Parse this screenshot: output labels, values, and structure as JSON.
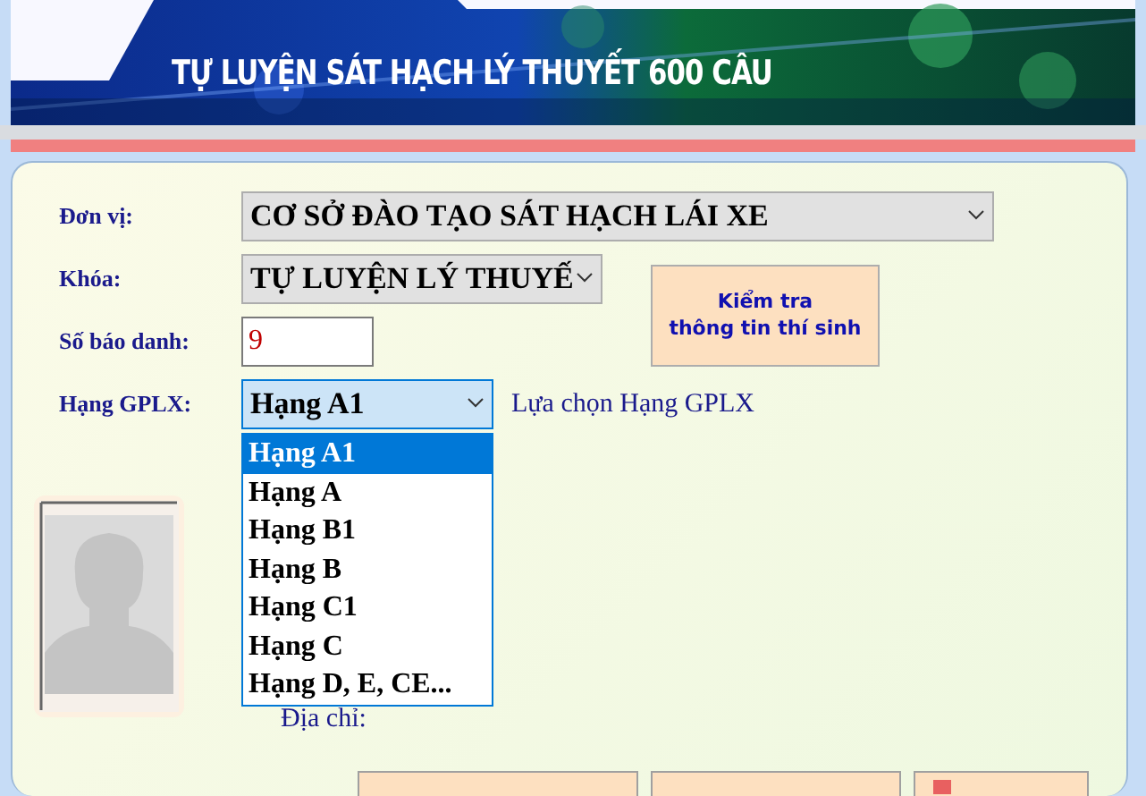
{
  "banner": {
    "title": "TỰ LUYỆN SÁT HẠCH LÝ THUYẾT 600 CÂU"
  },
  "form": {
    "fields": [
      {
        "kind": "select",
        "label": "Đơn vị:",
        "value": "CƠ SỞ ĐÀO TẠO SÁT HẠCH LÁI XE"
      },
      {
        "kind": "select",
        "label": "Khóa:",
        "value": "TỰ LUYỆN LÝ THUYẾ"
      },
      {
        "kind": "input",
        "label": "Số báo danh:",
        "value": "9"
      },
      {
        "kind": "select",
        "label": "Hạng GPLX:",
        "value": "Hạng A1",
        "hint": "Lựa chọn Hạng GPLX",
        "expanded": true,
        "options": [
          {
            "label": "Hạng A1",
            "selected": true
          },
          {
            "label": "Hạng A",
            "selected": false
          },
          {
            "label": "Hạng B1",
            "selected": false
          },
          {
            "label": "Hạng B",
            "selected": false
          },
          {
            "label": "Hạng C1",
            "selected": false
          },
          {
            "label": "Hạng C",
            "selected": false
          },
          {
            "label": "Hạng D, E, CE...",
            "selected": false
          }
        ]
      }
    ],
    "check_button": "Kiểm tra\nthông tin thí sinh",
    "address_label": "Địa chỉ:"
  }
}
